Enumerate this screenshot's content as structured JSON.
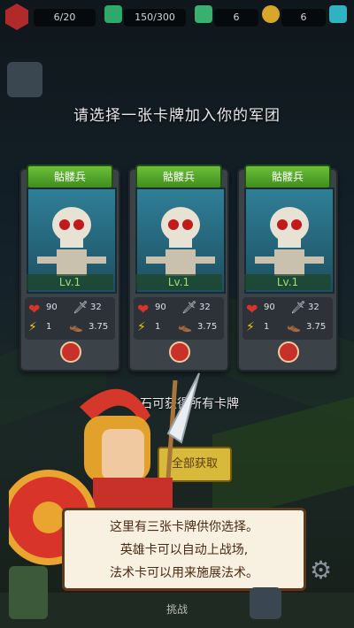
{
  "hud": {
    "counter1": "6/20",
    "counter2": "150/300",
    "counter3": "6",
    "counter4": "6"
  },
  "title": "请选择一张卡牌加入你的军团",
  "cards": [
    {
      "name": "骷髅兵",
      "level": "Lv.1",
      "hp": "90",
      "atk": "32",
      "cost": "1",
      "speed": "3.75"
    },
    {
      "name": "骷髅兵",
      "level": "Lv.1",
      "hp": "90",
      "atk": "32",
      "cost": "1",
      "speed": "3.75"
    },
    {
      "name": "骷髅兵",
      "level": "Lv.1",
      "hp": "90",
      "atk": "32",
      "cost": "1",
      "speed": "3.75"
    }
  ],
  "background_text": "石可获得所有卡牌",
  "background_button": "全部获取",
  "bottom_label": "挑战",
  "dialog": {
    "line1": "这里有三张卡牌供你选择。",
    "line2": "英雄卡可以自动上战场,",
    "line3": "法术卡可以用来施展法术。"
  },
  "colors": {
    "banner": "#4e9e27",
    "level_text": "#9fe06a",
    "dialog_bg": "#f8f0e0",
    "dialog_text": "#4a2a12"
  },
  "icons": [
    "heart-icon",
    "sword-icon",
    "lightning-icon",
    "boot-icon",
    "magnifier-icon",
    "gear-icon"
  ]
}
